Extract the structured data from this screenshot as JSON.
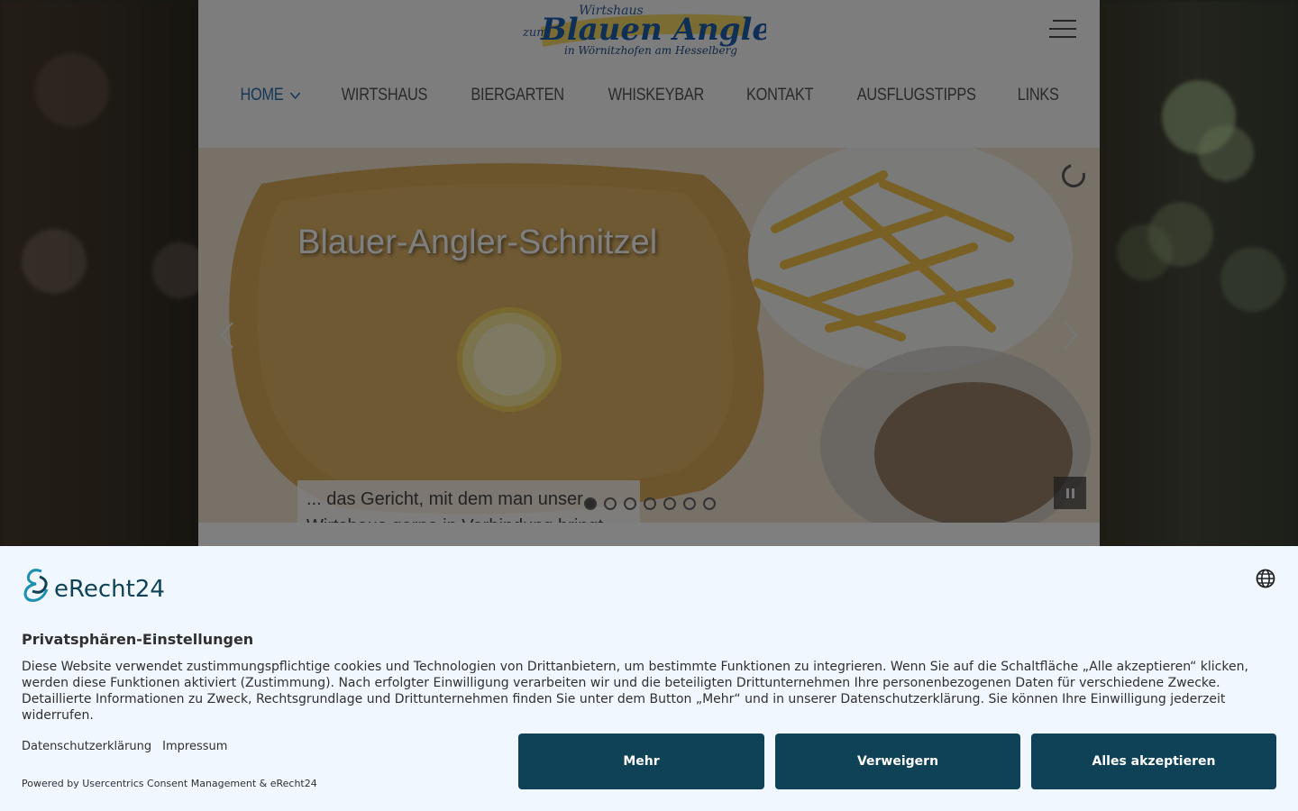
{
  "header": {
    "logo_top": "Wirtshaus",
    "logo_zum": "zum",
    "logo_main": "Blauen Angler",
    "logo_sub": "in Wörnitzhofen am Hesselberg"
  },
  "nav": {
    "items": [
      {
        "label": "HOME"
      },
      {
        "label": "WIRTSHAUS"
      },
      {
        "label": "BIERGARTEN"
      },
      {
        "label": "WHISKEYBAR"
      },
      {
        "label": "KONTAKT"
      },
      {
        "label": "AUSFLUGSTIPPS"
      },
      {
        "label": "LINKS"
      }
    ]
  },
  "slider": {
    "title": "Blauer-Angler-Schnitzel",
    "caption": "... das Gericht, mit dem man unser Wirtshaus gerne in Verbindung bringt",
    "dot_count": 7,
    "active_dot": 1
  },
  "consent": {
    "brand": "eRecht24",
    "title": "Privatsphären-Einstellungen",
    "text": "Diese Website verwendet zustimmungspflichtige cookies und Technologien von Drittanbietern, um bestimmte Funktionen zu integrieren. Wenn Sie auf die Schaltfläche „Alle akzeptieren“ klicken, werden diese Funktionen aktiviert (Zustimmung). Nach erfolgter Einwilligung verarbeiten wir und die beteiligten Drittunternehmen Ihre personenbezogenen Daten für verschiedene Zwecke. Detaillierte Informationen zu Zweck, Rechtsgrundlage und Drittunternehmen finden Sie unter dem Button „Mehr“ und in unserer Datenschutzerklärung. Sie können Ihre Einwilligung jederzeit widerrufen.",
    "link_privacy": "Datenschutzerklärung",
    "link_imprint": "Impressum",
    "powered": "Powered by Usercentrics Consent Management & eRecht24",
    "btn_more": "Mehr",
    "btn_deny": "Verweigern",
    "btn_accept": "Alles akzeptieren",
    "brand_color": "#0f4257"
  }
}
